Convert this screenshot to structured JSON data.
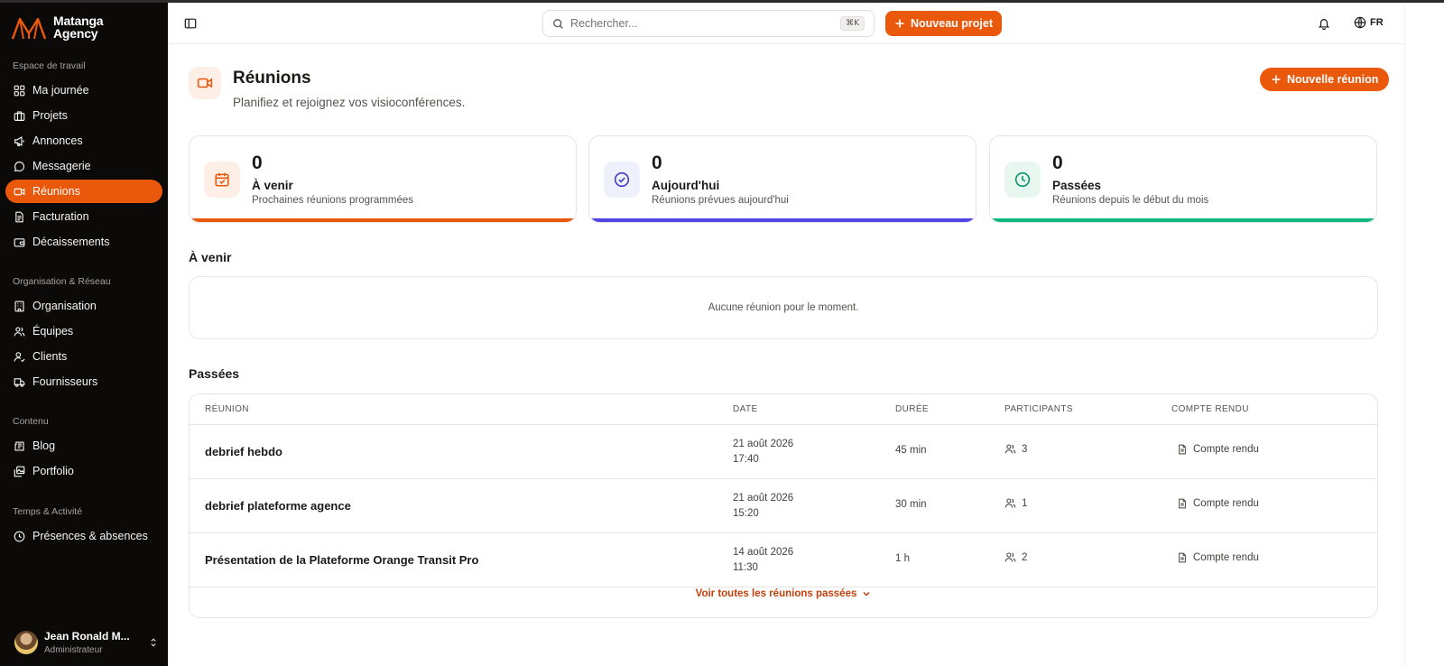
{
  "brand": {
    "name_line1": "Matanga",
    "name_line2": "Agency"
  },
  "sidebar": {
    "groups": [
      {
        "label": "Espace de travail"
      },
      {
        "label": "Organisation & Réseau"
      },
      {
        "label": "Contenu"
      },
      {
        "label": "Temps & Activité"
      }
    ],
    "items": [
      {
        "label": "Ma journée",
        "icon": "grid-icon"
      },
      {
        "label": "Projets",
        "icon": "briefcase-icon"
      },
      {
        "label": "Annonces",
        "icon": "megaphone-icon"
      },
      {
        "label": "Messagerie",
        "icon": "chat-icon"
      },
      {
        "label": "Réunions",
        "icon": "video-icon",
        "active": true
      },
      {
        "label": "Facturation",
        "icon": "invoice-icon"
      },
      {
        "label": "Décaissements",
        "icon": "wallet-icon"
      },
      {
        "label": "Organisation",
        "icon": "building-icon"
      },
      {
        "label": "Équipes",
        "icon": "users-icon"
      },
      {
        "label": "Clients",
        "icon": "user-check-icon"
      },
      {
        "label": "Fournisseurs",
        "icon": "truck-icon"
      },
      {
        "label": "Blog",
        "icon": "newspaper-icon"
      },
      {
        "label": "Portfolio",
        "icon": "images-icon"
      },
      {
        "label": "Présences & absences",
        "icon": "clock-icon"
      }
    ],
    "user": {
      "name": "Jean Ronald M...",
      "role": "Administrateur"
    }
  },
  "header": {
    "search_placeholder": "Rechercher...",
    "search_shortcut": "⌘K",
    "new_project_label": "Nouveau projet",
    "language": "FR"
  },
  "page": {
    "title": "Réunions",
    "subtitle": "Planifiez et rejoignez vos visioconférences.",
    "new_meeting_label": "Nouvelle réunion"
  },
  "stats": [
    {
      "value": "0",
      "label": "À venir",
      "desc": "Prochaines réunions programmées",
      "color": "#ea580c",
      "tint": "#fdeee6"
    },
    {
      "value": "0",
      "label": "Aujourd'hui",
      "desc": "Réunions prévues aujourd'hui",
      "color": "#4f46e5",
      "tint": "#eef0fc"
    },
    {
      "value": "0",
      "label": "Passées",
      "desc": "Réunions depuis le début du mois",
      "color": "#10b981",
      "tint": "#e7f7ef"
    }
  ],
  "upcoming": {
    "title": "À venir",
    "empty_text": "Aucune réunion pour le moment."
  },
  "past": {
    "title": "Passées",
    "columns": {
      "meeting": "RÉUNION",
      "date": "DATE",
      "duration": "DURÉE",
      "participants": "PARTICIPANTS",
      "report": "COMPTE RENDU"
    },
    "rows": [
      {
        "name": "debrief hebdo",
        "date": "21 août 2026",
        "time": "17:40",
        "duration": "45 min",
        "participants": "3",
        "report": "Compte rendu"
      },
      {
        "name": "debrief plateforme agence",
        "date": "21 août 2026",
        "time": "15:20",
        "duration": "30 min",
        "participants": "1",
        "report": "Compte rendu"
      },
      {
        "name": "Présentation de la Plateforme Orange Transit Pro",
        "date": "14 août 2026",
        "time": "11:30",
        "duration": "1 h",
        "participants": "2",
        "report": "Compte rendu"
      }
    ],
    "see_all_label": "Voir toutes les réunions passées"
  }
}
